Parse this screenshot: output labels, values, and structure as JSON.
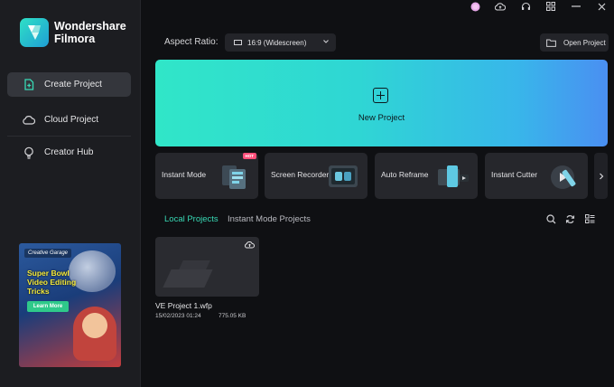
{
  "app": {
    "name_line1": "Wondershare",
    "name_line2": "Filmora",
    "accent": "#38d9b5"
  },
  "sidebar": {
    "items": [
      {
        "label": "Create Project",
        "icon": "new-file-icon",
        "active": true
      },
      {
        "label": "Cloud Project",
        "icon": "cloud-icon",
        "active": false
      },
      {
        "label": "Creator Hub",
        "icon": "lightbulb-icon",
        "active": false
      }
    ],
    "promo": {
      "badge": "Creative Garage",
      "title": "Super Bowl Video Editing Tricks",
      "button": "Learn More"
    }
  },
  "topbar": {
    "icons": [
      "avatar-icon",
      "cloud-sync-icon",
      "headset-icon",
      "grid-icon",
      "minimize-icon",
      "close-icon"
    ]
  },
  "toolbar": {
    "aspect_label": "Aspect Ratio:",
    "aspect_value": "16:9 (Widescreen)",
    "open_project": "Open Project"
  },
  "hero": {
    "label": "New Project"
  },
  "features": [
    {
      "label": "Instant Mode",
      "badge": "HOT"
    },
    {
      "label": "Screen Recorder"
    },
    {
      "label": "Auto Reframe"
    },
    {
      "label": "Instant Cutter"
    }
  ],
  "tabs": [
    {
      "label": "Local Projects",
      "active": true
    },
    {
      "label": "Instant Mode Projects",
      "active": false
    }
  ],
  "projects": [
    {
      "name": "VE Project 1.wfp",
      "date": "15/02/2023 01:24",
      "size": "775.05 KB"
    }
  ]
}
